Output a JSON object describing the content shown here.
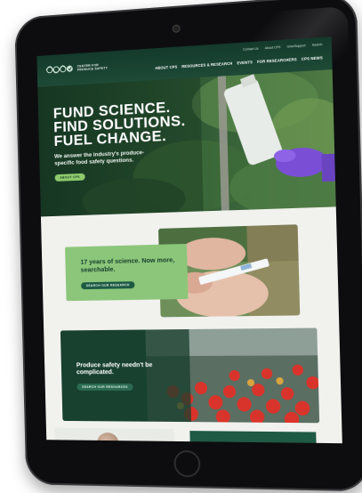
{
  "header": {
    "logo_line1": "CENTER FOR",
    "logo_line2": "PRODUCE SAFETY",
    "utility_links": [
      "Contact Us",
      "About CPS",
      "Give/Support",
      "Search"
    ],
    "nav_items": [
      "ABOUT CPS",
      "RESOURCES & RESEARCH",
      "EVENTS",
      "FOR RESEARCHERS",
      "CPS NEWS"
    ]
  },
  "hero": {
    "headline": [
      "FUND SCIENCE.",
      "FIND SOLUTIONS.",
      "FUEL CHANGE."
    ],
    "subtext": "We answer the industry's produce-specific food safety questions.",
    "button_label": "ABOUT CPS"
  },
  "research_card": {
    "title": "17 years of science. Now more, searchable.",
    "button_label": "SEARCH OUR RESEARCH"
  },
  "resources_card": {
    "title": "Produce safety needn't be complicated.",
    "button_label": "SEARCH OUR RESOURCES"
  },
  "colors": {
    "brand_dark_green": "#143a2c",
    "accent_green": "#8fca6d",
    "button_green": "#1d5a44"
  }
}
